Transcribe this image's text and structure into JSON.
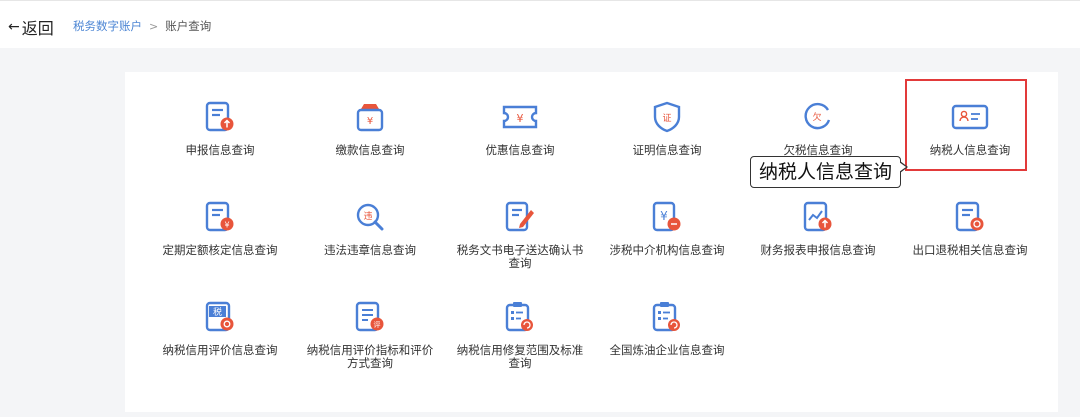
{
  "header": {
    "back_label": "返回",
    "breadcrumb": {
      "parent": "税务数字账户",
      "separator": ">",
      "current": "账户查询"
    }
  },
  "items": [
    {
      "label": "申报信息查询",
      "icon": "declaration-doc-icon"
    },
    {
      "label": "缴款信息查询",
      "icon": "payment-bag-icon"
    },
    {
      "label": "优惠信息查询",
      "icon": "discount-ticket-icon"
    },
    {
      "label": "证明信息查询",
      "icon": "certificate-shield-icon"
    },
    {
      "label": "欠税信息查询",
      "icon": "tax-arrears-icon"
    },
    {
      "label": "纳税人信息查询",
      "icon": "taxpayer-id-card-icon"
    },
    {
      "label": "定期定额核定信息查询",
      "icon": "fixed-quota-doc-icon"
    },
    {
      "label": "违法违章信息查询",
      "icon": "violation-search-icon"
    },
    {
      "label": "税务文书电子送达确认书查询",
      "icon": "document-edit-icon"
    },
    {
      "label": "涉税中介机构信息查询",
      "icon": "agency-icon"
    },
    {
      "label": "财务报表申报信息查询",
      "icon": "financial-report-icon"
    },
    {
      "label": "出口退税相关信息查询",
      "icon": "export-refund-icon"
    },
    {
      "label": "纳税信用评价信息查询",
      "icon": "credit-rating-icon"
    },
    {
      "label": "纳税信用评价指标和评价方式查询",
      "icon": "credit-criteria-icon"
    },
    {
      "label": "纳税信用修复范围及标准查询",
      "icon": "credit-repair-icon"
    },
    {
      "label": "全国炼油企业信息查询",
      "icon": "refinery-enterprise-icon"
    }
  ],
  "tooltip": "纳税人信息查询",
  "colors": {
    "accent_blue": "#4a7fd6",
    "accent_red": "#e8553b",
    "highlight": "#e23a3a"
  }
}
